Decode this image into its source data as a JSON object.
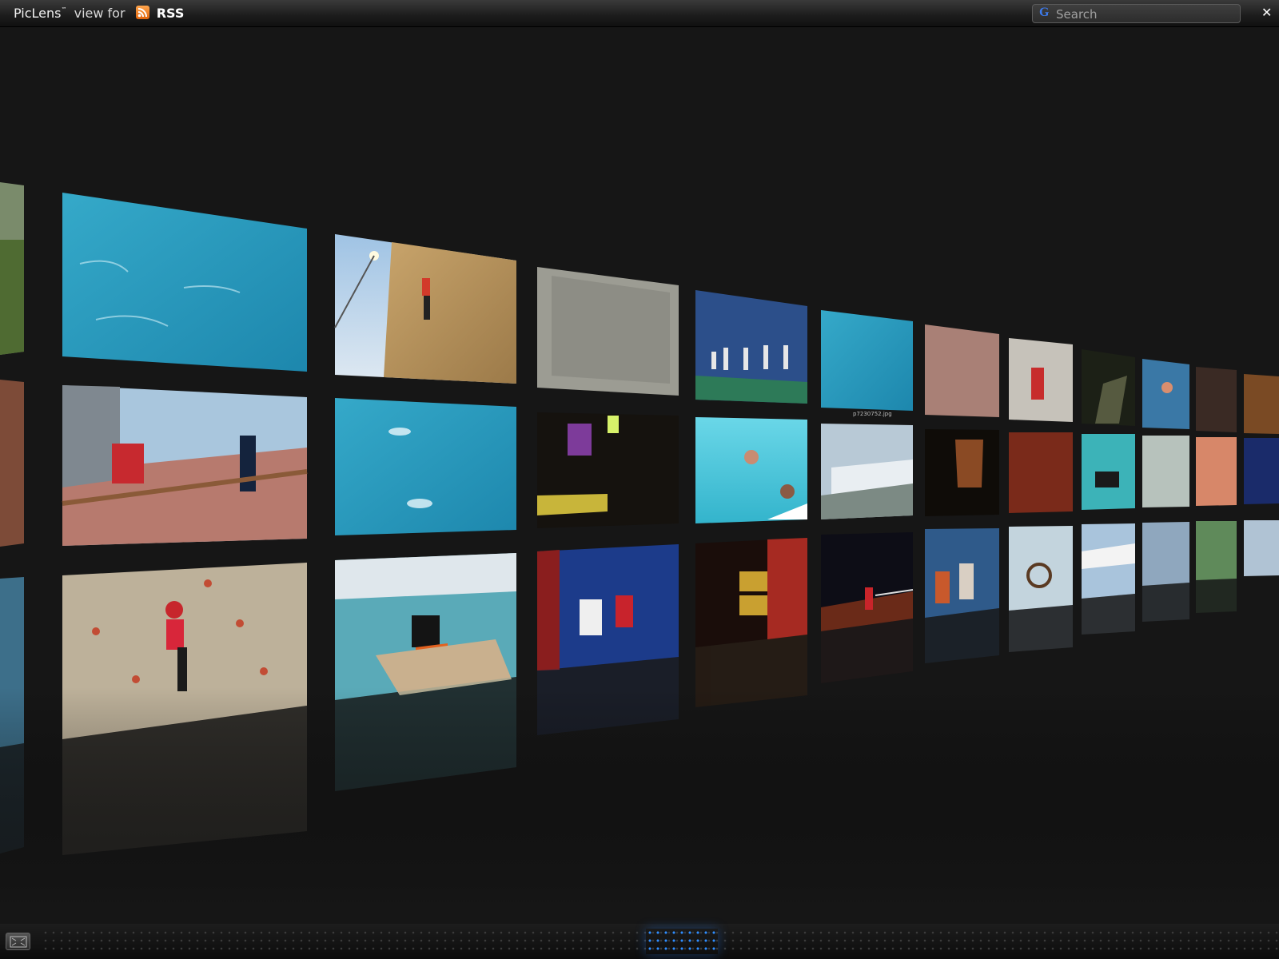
{
  "app": {
    "title": "PicLens",
    "tm": "™",
    "view_for": "view for",
    "source_label": "RSS",
    "close_label": "✕"
  },
  "search": {
    "placeholder": "Search",
    "engine_glyph": "G"
  },
  "gallery": {
    "caption": "p7230752.jpg",
    "photo_count_visible": 36
  },
  "colors": {
    "accent": "#2f8dff",
    "rss": "#f07d1b"
  }
}
